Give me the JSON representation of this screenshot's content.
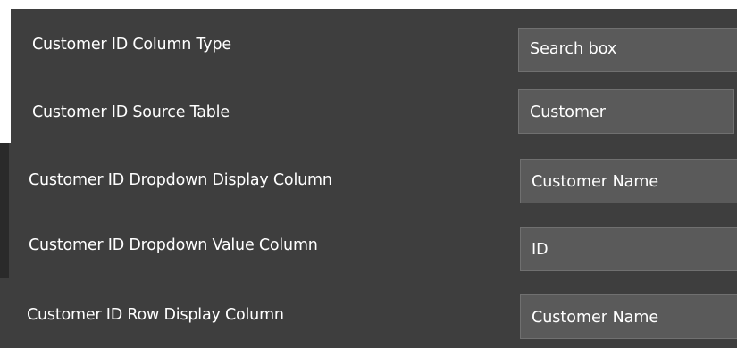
{
  "fields": [
    {
      "label": "Customer ID Column Type",
      "value": "Search box"
    },
    {
      "label": "Customer ID Source Table",
      "value": "Customer"
    },
    {
      "label": "Customer ID Dropdown Display Column",
      "value": "Customer Name"
    },
    {
      "label": "Customer ID Dropdown Value Column",
      "value": "ID"
    },
    {
      "label": "Customer ID  Row Display Column",
      "value": "Customer Name"
    }
  ]
}
